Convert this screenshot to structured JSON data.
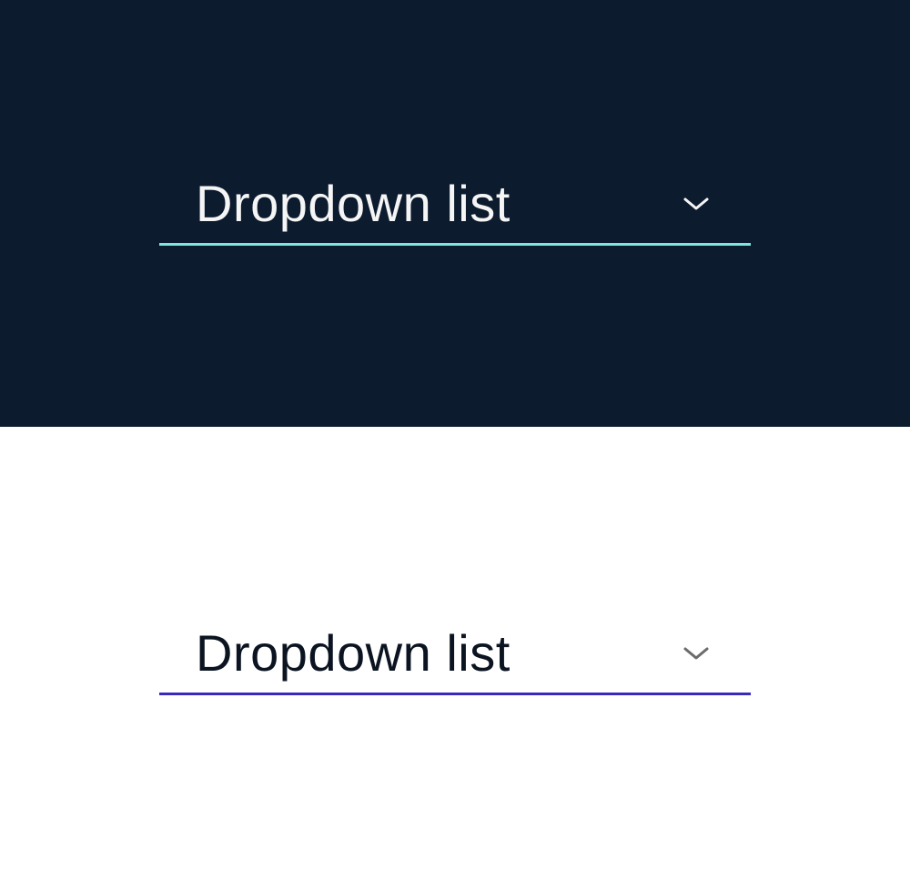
{
  "dark": {
    "label": "Dropdown list",
    "accent": "#7fe5df",
    "bg": "#0c1b2e",
    "text": "#f5f5f5"
  },
  "light": {
    "label": "Dropdown list",
    "accent": "#372bbf",
    "bg": "#ffffff",
    "text": "#0b1420"
  }
}
